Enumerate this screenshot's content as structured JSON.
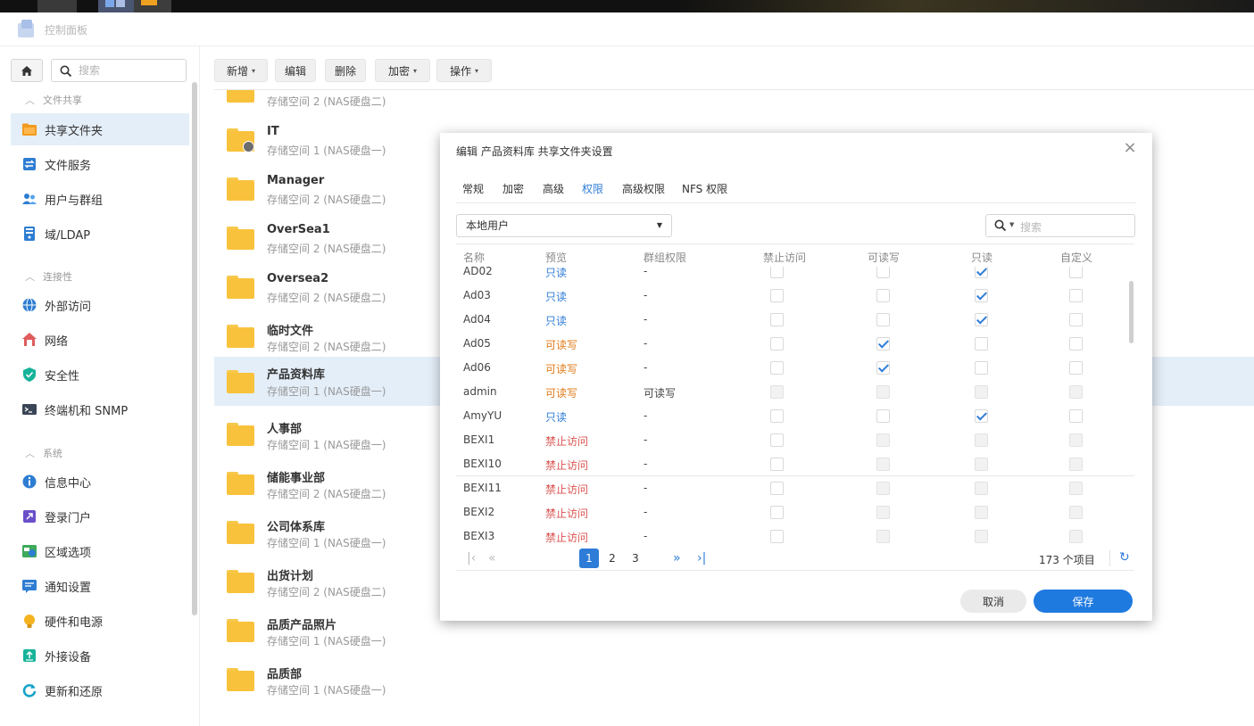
{
  "window": {
    "title": "控制面板"
  },
  "sidebar": {
    "search_placeholder": "搜索",
    "sections": {
      "file_sharing": "文件共享",
      "connectivity": "连接性",
      "system": "系统"
    },
    "items": [
      {
        "label": "共享文件夹",
        "icon": "shared-folder-icon"
      },
      {
        "label": "文件服务",
        "icon": "file-services-icon"
      },
      {
        "label": "用户与群组",
        "icon": "users-icon"
      },
      {
        "label": "域/LDAP",
        "icon": "domain-icon"
      },
      {
        "label": "外部访问",
        "icon": "external-access-icon"
      },
      {
        "label": "网络",
        "icon": "network-icon"
      },
      {
        "label": "安全性",
        "icon": "security-shield-icon"
      },
      {
        "label": "终端机和 SNMP",
        "icon": "terminal-icon"
      },
      {
        "label": "信息中心",
        "icon": "info-icon"
      },
      {
        "label": "登录门户",
        "icon": "login-portal-icon"
      },
      {
        "label": "区域选项",
        "icon": "regional-icon"
      },
      {
        "label": "通知设置",
        "icon": "notification-icon"
      },
      {
        "label": "硬件和电源",
        "icon": "hardware-power-icon"
      },
      {
        "label": "外接设备",
        "icon": "external-device-icon"
      },
      {
        "label": "更新和还原",
        "icon": "update-restore-icon"
      }
    ]
  },
  "toolbar": {
    "create": "新增",
    "edit": "编辑",
    "delete": "删除",
    "encrypt": "加密",
    "action": "操作"
  },
  "folders": [
    {
      "name": "",
      "sub": "存储空间 2 (NAS硬盘二)"
    },
    {
      "name": "IT",
      "sub": "存储空间 1 (NAS硬盘一)"
    },
    {
      "name": "Manager",
      "sub": "存储空间 2 (NAS硬盘二)"
    },
    {
      "name": "OverSea1",
      "sub": "存储空间 2 (NAS硬盘二)"
    },
    {
      "name": "Oversea2",
      "sub": "存储空间 2 (NAS硬盘二)"
    },
    {
      "name": "临时文件",
      "sub": "存储空间 2 (NAS硬盘二)"
    },
    {
      "name": "产品资料库",
      "sub": "存储空间 1 (NAS硬盘一)"
    },
    {
      "name": "人事部",
      "sub": "存储空间 1 (NAS硬盘一)"
    },
    {
      "name": "储能事业部",
      "sub": "存储空间 2 (NAS硬盘二)"
    },
    {
      "name": "公司体系库",
      "sub": "存储空间 1 (NAS硬盘一)"
    },
    {
      "name": "出货计划",
      "sub": "存储空间 2 (NAS硬盘二)"
    },
    {
      "name": "品质产品照片",
      "sub": "存储空间 1 (NAS硬盘一)"
    },
    {
      "name": "品质部",
      "sub": "存储空间 1 (NAS硬盘一)"
    }
  ],
  "modal": {
    "title": "编辑 产品资料库 共享文件夹设置",
    "tabs": [
      "常规",
      "加密",
      "高级",
      "权限",
      "高级权限",
      "NFS 权限"
    ],
    "user_type": "本地用户",
    "search_placeholder": "搜索",
    "columns": [
      "名称",
      "预览",
      "群组权限",
      "禁止访问",
      "可读写",
      "只读",
      "自定义"
    ],
    "rows": [
      {
        "name": "AD02",
        "preview": "只读",
        "group": "-",
        "perm": "ro"
      },
      {
        "name": "Ad03",
        "preview": "只读",
        "group": "-",
        "perm": "ro"
      },
      {
        "name": "Ad04",
        "preview": "只读",
        "group": "-",
        "perm": "ro"
      },
      {
        "name": "Ad05",
        "preview": "可读写",
        "group": "-",
        "perm": "rw"
      },
      {
        "name": "Ad06",
        "preview": "可读写",
        "group": "-",
        "perm": "rw"
      },
      {
        "name": "admin",
        "preview": "可读写",
        "group": "可读写",
        "perm": "admin"
      },
      {
        "name": "AmyYU",
        "preview": "只读",
        "group": "-",
        "perm": "ro"
      },
      {
        "name": "BEXI1",
        "preview": "禁止访问",
        "group": "-",
        "perm": "deny"
      },
      {
        "name": "BEXI10",
        "preview": "禁止访问",
        "group": "-",
        "perm": "deny"
      },
      {
        "name": "BEXI11",
        "preview": "禁止访问",
        "group": "-",
        "perm": "deny"
      },
      {
        "name": "BEXI2",
        "preview": "禁止访问",
        "group": "-",
        "perm": "deny"
      },
      {
        "name": "BEXI3",
        "preview": "禁止访问",
        "group": "-",
        "perm": "deny"
      }
    ],
    "pages": [
      "1",
      "2",
      "3"
    ],
    "current_page": "1",
    "total": "173 个项目",
    "cancel": "取消",
    "save": "保存"
  },
  "colors": {
    "accent": "#2e7cd8",
    "read_only": "#2e7cd8",
    "read_write": "#e07b1a",
    "deny": "#d9534f",
    "folder": "#f9c23c",
    "selected_row": "#e4eef8"
  }
}
